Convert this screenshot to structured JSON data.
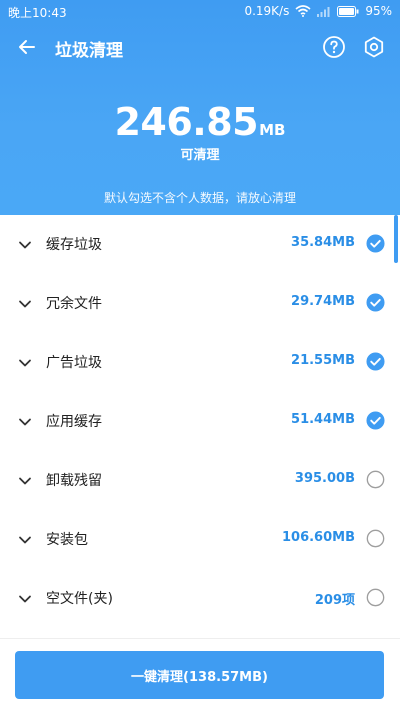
{
  "status_bar": {
    "time": "晚上10:43",
    "network_speed": "0.19K/s",
    "battery": "95%"
  },
  "toolbar": {
    "title": "垃圾清理"
  },
  "summary": {
    "size_value": "246.85",
    "size_unit": "MB",
    "caption": "可清理",
    "notice": "默认勾选不含个人数据，请放心清理"
  },
  "items": [
    {
      "name": "缓存垃圾",
      "size": "35.84MB",
      "checked": true
    },
    {
      "name": "冗余文件",
      "size": "29.74MB",
      "checked": true
    },
    {
      "name": "广告垃圾",
      "size": "21.55MB",
      "checked": true
    },
    {
      "name": "应用缓存",
      "size": "51.44MB",
      "checked": true
    },
    {
      "name": "卸载残留",
      "size": "395.00B",
      "checked": false
    },
    {
      "name": "安装包",
      "size": "106.60MB",
      "checked": false
    },
    {
      "name": "空文件(夹)",
      "size": "209项",
      "checked": false
    }
  ],
  "action": {
    "clean_label": "一键清理(138.57MB)"
  },
  "colors": {
    "accent": "#3f9cf2",
    "size_text": "#2a8ee6",
    "unchecked_border": "#9e9e9e"
  }
}
